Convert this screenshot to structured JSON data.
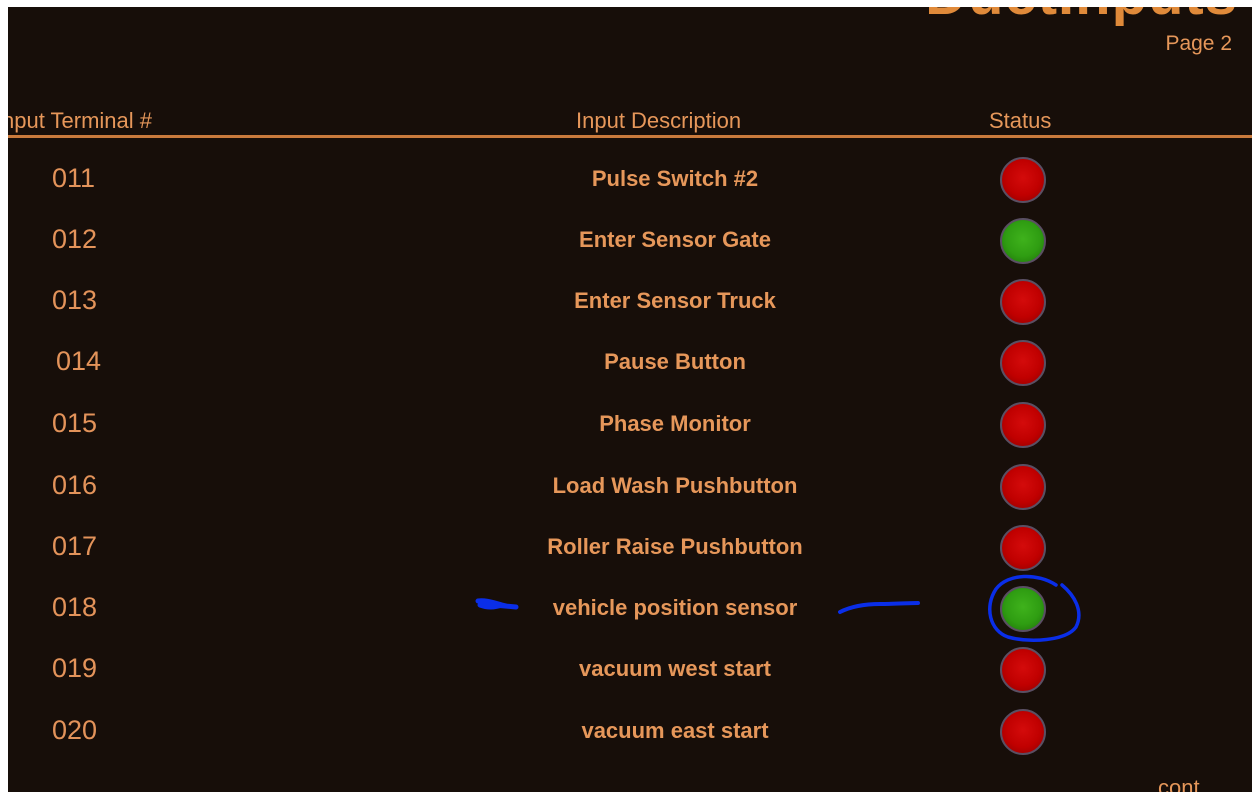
{
  "header": {
    "title": "DuctInputs",
    "page": "Page 2"
  },
  "columns": {
    "terminal": "nput Terminal #",
    "description": "Input Description",
    "status": "Status"
  },
  "rows": [
    {
      "terminal": "011",
      "description": "Pulse Switch #2",
      "status": "off"
    },
    {
      "terminal": "012",
      "description": "Enter Sensor Gate",
      "status": "on"
    },
    {
      "terminal": "013",
      "description": "Enter Sensor Truck",
      "status": "off"
    },
    {
      "terminal": "014",
      "description": "Pause Button",
      "status": "off"
    },
    {
      "terminal": "015",
      "description": "Phase Monitor",
      "status": "off"
    },
    {
      "terminal": "016",
      "description": "Load Wash Pushbutton",
      "status": "off"
    },
    {
      "terminal": "017",
      "description": "Roller Raise Pushbutton",
      "status": "off"
    },
    {
      "terminal": "018",
      "description": "vehicle position sensor",
      "status": "on"
    },
    {
      "terminal": "019",
      "description": "vacuum west start",
      "status": "off"
    },
    {
      "terminal": "020",
      "description": "vacuum east start",
      "status": "off"
    }
  ],
  "footer": {
    "cont": "cont"
  },
  "colors": {
    "background": "#170e09",
    "text": "#e6975a",
    "status_on": "#2f9d12",
    "status_off": "#c00000",
    "annotation": "#0a2ee8"
  }
}
